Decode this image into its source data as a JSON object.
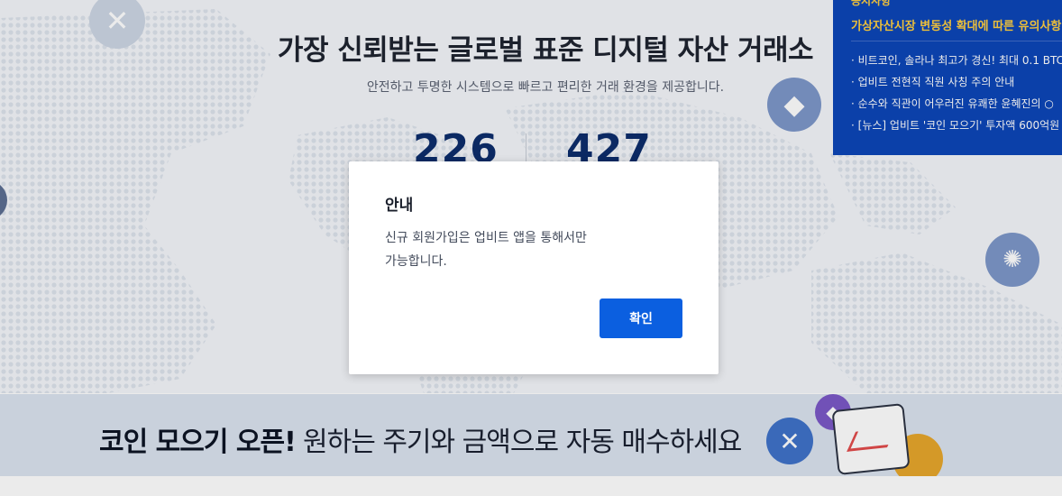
{
  "hero": {
    "title": "가장 신뢰받는 글로벌 표준 디지털 자산 거래소",
    "subtitle": "안전하고 투명한 시스템으로 빠르고 편리한 거래 환경을 제공합니다.",
    "stat_left": "226",
    "stat_right": "427"
  },
  "notice": {
    "category": "공지사항",
    "headline": "가상자산시장 변동성 확대에 따른 유의사항 안내",
    "items": [
      "비트코인, 솔라나 최고가 경신! 최대 0.1 BTC",
      "업비트 전현직 직원 사칭 주의 안내",
      "순수와 직관이 어우러진 유쾌한 윤혜진의 ○",
      "[뉴스] 업비트 '코인 모으기' 투자액 600억원"
    ]
  },
  "banner": {
    "strong": "코인 모으기 오픈!",
    "text": "원하는 주기와 금액으로 자동 매수하세요"
  },
  "modal": {
    "title": "안내",
    "body_line1": "신규 회원가입은 업비트 앱을 통해서만",
    "body_line2": "가능합니다.",
    "confirm": "확인"
  },
  "colors": {
    "notice_bg": "#0d46b8",
    "notice_accent": "#ffcf3f",
    "stat": "#0d2d6c",
    "confirm_button": "#0b5fe0"
  }
}
